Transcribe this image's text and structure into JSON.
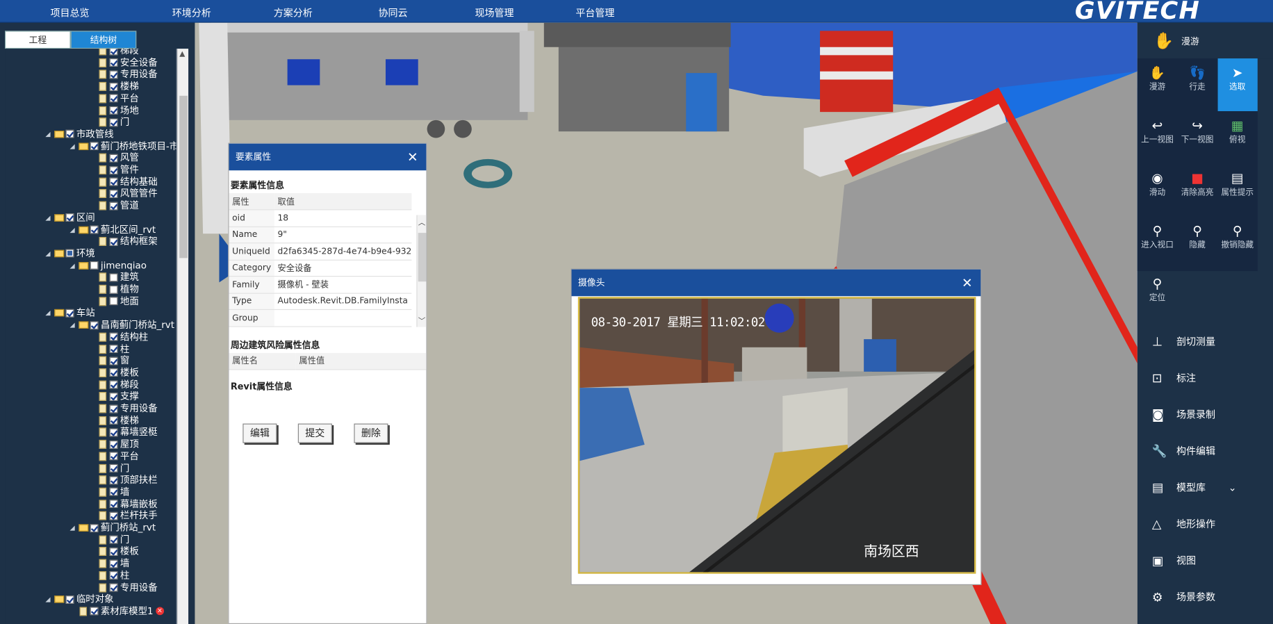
{
  "nav": {
    "items": [
      "项目总览",
      "环境分析",
      "方案分析",
      "协同云",
      "现场管理",
      "平台管理"
    ],
    "logo": "GVITECH"
  },
  "left": {
    "tabs": [
      "工程",
      "结构树"
    ],
    "tree": [
      {
        "label": "梯段",
        "level": 3,
        "type": "leaf",
        "check": "on"
      },
      {
        "label": "安全设备",
        "level": 3,
        "type": "leaf",
        "check": "on"
      },
      {
        "label": "专用设备",
        "level": 3,
        "type": "leaf",
        "check": "on"
      },
      {
        "label": "楼梯",
        "level": 3,
        "type": "leaf",
        "check": "on"
      },
      {
        "label": "平台",
        "level": 3,
        "type": "leaf",
        "check": "on"
      },
      {
        "label": "场地",
        "level": 3,
        "type": "leaf",
        "check": "on"
      },
      {
        "label": "门",
        "level": 3,
        "type": "leaf",
        "check": "on"
      },
      {
        "label": "市政管线",
        "level": 1,
        "type": "folder",
        "check": "on"
      },
      {
        "label": "蓟门桥地铁项目-市",
        "level": 2,
        "type": "folder",
        "check": "on"
      },
      {
        "label": "风管",
        "level": 3,
        "type": "leaf",
        "check": "on"
      },
      {
        "label": "管件",
        "level": 3,
        "type": "leaf",
        "check": "on"
      },
      {
        "label": "结构基础",
        "level": 3,
        "type": "leaf",
        "check": "on"
      },
      {
        "label": "风管管件",
        "level": 3,
        "type": "leaf",
        "check": "on"
      },
      {
        "label": "管道",
        "level": 3,
        "type": "leaf",
        "check": "on"
      },
      {
        "label": "区间",
        "level": 1,
        "type": "folder",
        "check": "on"
      },
      {
        "label": "蓟北区间_rvt",
        "level": 2,
        "type": "folder",
        "check": "on"
      },
      {
        "label": "结构框架",
        "level": 3,
        "type": "leaf",
        "check": "on"
      },
      {
        "label": "环境",
        "level": 1,
        "type": "folder",
        "check": "part"
      },
      {
        "label": "jimenqiao",
        "level": 2,
        "type": "folder",
        "check": "off"
      },
      {
        "label": "建筑",
        "level": 3,
        "type": "leaf",
        "check": "off"
      },
      {
        "label": "植物",
        "level": 3,
        "type": "leaf",
        "check": "off"
      },
      {
        "label": "地面",
        "level": 3,
        "type": "leaf",
        "check": "off"
      },
      {
        "label": "车站",
        "level": 1,
        "type": "folder",
        "check": "on"
      },
      {
        "label": "昌南蓟门桥站_rvt",
        "level": 2,
        "type": "folder",
        "check": "on"
      },
      {
        "label": "结构柱",
        "level": 3,
        "type": "leaf",
        "check": "on"
      },
      {
        "label": "柱",
        "level": 3,
        "type": "leaf",
        "check": "on"
      },
      {
        "label": "窗",
        "level": 3,
        "type": "leaf",
        "check": "on"
      },
      {
        "label": "楼板",
        "level": 3,
        "type": "leaf",
        "check": "on"
      },
      {
        "label": "梯段",
        "level": 3,
        "type": "leaf",
        "check": "on"
      },
      {
        "label": "支撑",
        "level": 3,
        "type": "leaf",
        "check": "on"
      },
      {
        "label": "专用设备",
        "level": 3,
        "type": "leaf",
        "check": "on"
      },
      {
        "label": "楼梯",
        "level": 3,
        "type": "leaf",
        "check": "on"
      },
      {
        "label": "幕墙竖梃",
        "level": 3,
        "type": "leaf",
        "check": "on"
      },
      {
        "label": "屋顶",
        "level": 3,
        "type": "leaf",
        "check": "on"
      },
      {
        "label": "平台",
        "level": 3,
        "type": "leaf",
        "check": "on"
      },
      {
        "label": "门",
        "level": 3,
        "type": "leaf",
        "check": "on"
      },
      {
        "label": "顶部扶栏",
        "level": 3,
        "type": "leaf",
        "check": "on"
      },
      {
        "label": "墙",
        "level": 3,
        "type": "leaf",
        "check": "on"
      },
      {
        "label": "幕墙嵌板",
        "level": 3,
        "type": "leaf",
        "check": "on"
      },
      {
        "label": "栏杆扶手",
        "level": 3,
        "type": "leaf",
        "check": "on"
      },
      {
        "label": "蓟门桥站_rvt",
        "level": 2,
        "type": "folder",
        "check": "on"
      },
      {
        "label": "门",
        "level": 3,
        "type": "leaf",
        "check": "on"
      },
      {
        "label": "楼板",
        "level": 3,
        "type": "leaf",
        "check": "on"
      },
      {
        "label": "墙",
        "level": 3,
        "type": "leaf",
        "check": "on"
      },
      {
        "label": "柱",
        "level": 3,
        "type": "leaf",
        "check": "on"
      },
      {
        "label": "专用设备",
        "level": 3,
        "type": "leaf",
        "check": "on"
      },
      {
        "label": "临时对象",
        "level": 1,
        "type": "folder",
        "check": "on"
      },
      {
        "label": "素材库模型1",
        "level": 2,
        "type": "doc",
        "check": "on",
        "deletable": true
      }
    ]
  },
  "prop": {
    "title": "要素属性",
    "close": "✕",
    "section1": "要素属性信息",
    "head": [
      "属性",
      "取值"
    ],
    "rows": [
      [
        "oid",
        "18"
      ],
      [
        "Name",
        "9\""
      ],
      [
        "UniqueId",
        "d2fa6345-287d-4e74-b9e4-932"
      ],
      [
        "Category",
        "安全设备"
      ],
      [
        "Family",
        "摄像机 - 壁装"
      ],
      [
        "Type",
        "Autodesk.Revit.DB.FamilyInsta"
      ],
      [
        "Group",
        ""
      ]
    ],
    "section2": "周边建筑风险属性信息",
    "head2": [
      "属性名",
      "属性值"
    ],
    "section3": "Revit属性信息",
    "buttons": [
      "编辑",
      "提交",
      "删除"
    ]
  },
  "camera": {
    "title": "摄像头",
    "close": "✕",
    "timestamp": "08-30-2017 星期三 11:02:02",
    "location": "南场区西"
  },
  "right": {
    "top": {
      "label": "漫游",
      "icon": "hand-icon"
    },
    "grid": [
      {
        "label": "漫游",
        "icon": "hand-icon"
      },
      {
        "label": "行走",
        "icon": "footprints-icon"
      },
      {
        "label": "选取",
        "icon": "cursor-icon",
        "active": true
      },
      {
        "label": "上一视图",
        "icon": "back-arrow-icon"
      },
      {
        "label": "下一视图",
        "icon": "forward-arrow-icon"
      },
      {
        "label": "俯视",
        "icon": "map-icon"
      },
      {
        "label": "滑动",
        "icon": "eye-icon"
      },
      {
        "label": "清除高亮",
        "icon": "cube-icon"
      },
      {
        "label": "属性提示",
        "icon": "document-icon"
      },
      {
        "label": "进入视口",
        "icon": "person-pin-icon"
      },
      {
        "label": "隐藏",
        "icon": "person-pin-icon"
      },
      {
        "label": "撤销隐藏",
        "icon": "person-pin-icon"
      },
      {
        "label": "定位",
        "icon": "person-pin-icon"
      }
    ],
    "menu": [
      {
        "label": "剖切测量",
        "icon": "measure-icon"
      },
      {
        "label": "标注",
        "icon": "annotation-icon"
      },
      {
        "label": "场景录制",
        "icon": "camera-icon"
      },
      {
        "label": "构件编辑",
        "icon": "wrench-icon"
      },
      {
        "label": "模型库",
        "icon": "database-icon",
        "chevron": "⌄"
      },
      {
        "label": "地形操作",
        "icon": "terrain-icon"
      },
      {
        "label": "视图",
        "icon": "layout-icon"
      },
      {
        "label": "场景参数",
        "icon": "gear-icon"
      }
    ]
  },
  "colors": {
    "nav": "#1a4f9c",
    "panel": "#1d3147",
    "active": "#1f8fe1"
  }
}
